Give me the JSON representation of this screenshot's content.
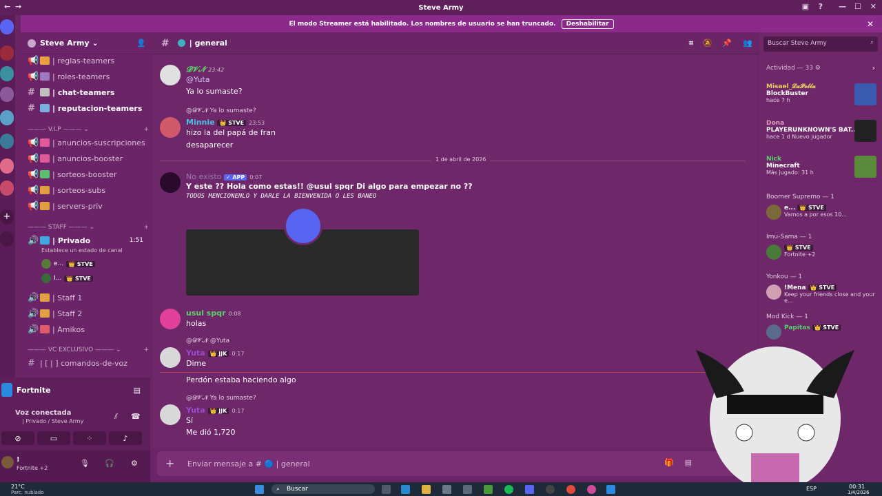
{
  "window": {
    "title": "Steve Army"
  },
  "streamer_banner": {
    "text": "El modo Streamer está habilitado. Los nombres de usuario se han truncado.",
    "button": "Deshabilitar"
  },
  "server": {
    "name": "Steve Army ⌄"
  },
  "channels_top": [
    {
      "name": "| reglas-teamers",
      "bright": false
    },
    {
      "name": "| roles-teamers",
      "bright": false
    },
    {
      "name": "| chat-teamers",
      "bright": true
    },
    {
      "name": "| reputacion-teamers",
      "bright": true
    }
  ],
  "category_vip": "——— V.I.P ——— ⌄",
  "channels_vip": [
    {
      "name": "| anuncios-suscripciones"
    },
    {
      "name": "| anuncios-booster"
    },
    {
      "name": "| sorteos-booster"
    },
    {
      "name": "| sorteos-subs"
    },
    {
      "name": "| servers-priv"
    }
  ],
  "category_staff": "——— STAFF ——— ⌄",
  "voice_private": {
    "name": "| Privado",
    "timer": "1:51",
    "status": "Establece un estado de canal"
  },
  "voice_users": [
    {
      "name": "e...",
      "badge": "👑 STVE"
    },
    {
      "name": "I...",
      "badge": "👑 STVE"
    }
  ],
  "staff_channels": [
    {
      "name": "| Staff 1"
    },
    {
      "name": "| Staff 2"
    },
    {
      "name": "| Amikos"
    }
  ],
  "category_vc": "——— VC EXCLUSIVO ——— ⌄",
  "vc_channel": "| [ | ] comandos-de-voz",
  "activity_card": {
    "game": "Fortnite"
  },
  "voice_panel": {
    "status": "Voz conectada",
    "location": "| Privado / Steve Army"
  },
  "user_panel": {
    "name": "!",
    "status": "Fortnite +2"
  },
  "chat": {
    "channel": "| general",
    "date_separator": "1 de abril de 2026",
    "composer_placeholder": "Enviar mensaje a # 🔵 | general"
  },
  "messages": [
    {
      "author": "𝓓𝓥𝓝",
      "time": "23:42",
      "reply": "",
      "lines": [
        "@Yuta",
        "Ya lo sumaste?"
      ]
    },
    {
      "author": "Minnie",
      "time": "23:53",
      "reply": "@𝓓𝓥𝓝 Ya lo sumaste?",
      "lines": [
        "hizo la del papá de fran",
        "desaparecer"
      ]
    },
    {
      "author": "No existo",
      "time": "0:07",
      "reply": "",
      "lines": [
        "Y este ?? Hola como estas!! @usul spqr Di algo para empezar no ??",
        "TODOS MENCIONENLO Y DARLE LA BIENVENIDA O LES BANEO"
      ]
    },
    {
      "author": "usul spqr",
      "time": "0:08",
      "reply": "",
      "lines": [
        "holas"
      ]
    },
    {
      "author": "Yuta",
      "time": "0:17",
      "reply": "@𝓓𝓥𝓝 @Yuta",
      "lines": [
        "Dime"
      ]
    },
    {
      "author": "",
      "time": "",
      "reply": "",
      "lines": [
        "Perdón estaba haciendo algo"
      ]
    },
    {
      "author": "Yuta",
      "time": "0:17",
      "reply": "@𝓓𝓥𝓝 Ya lo sumaste?",
      "lines": [
        "Sí",
        "Me dió 1,720"
      ]
    }
  ],
  "badges": {
    "stve": "👑 STVE",
    "jjk": "👑 JJK",
    "app": "✓ APP"
  },
  "right_panel": {
    "search_placeholder": "Buscar Steve Army",
    "activity_header": "Actividad — 33 ⚙",
    "activities": [
      {
        "name": "Misael_𝓛𝓪𝓟𝓸𝓵𝓵𝓪",
        "game": "BlockBuster",
        "sub": "hace 7 h"
      },
      {
        "name": "Dona",
        "game": "PLAYERUNKNOWN'S BAT...",
        "sub": "hace 1 d   Nuevo jugador"
      },
      {
        "name": "Nick",
        "game": "Minecraft",
        "sub": "Más jugado: 31 h"
      }
    ],
    "groups": [
      {
        "title": "Boomer Supremo — 1",
        "member": "e...",
        "badge": "👑 STVE",
        "sub": "Vamos a por esos 10..."
      },
      {
        "title": "Imu-Sama — 1",
        "member": "",
        "badge": "👑 STVE",
        "sub": "Fortnite +2"
      },
      {
        "title": "Yonkou — 1",
        "member": "!Mena",
        "badge": "👑 STVE",
        "sub": "Keep your friends close and your e..."
      },
      {
        "title": "Mod Kick — 1",
        "member": "Papitas",
        "badge": "👑 STVE",
        "sub": ""
      }
    ]
  },
  "taskbar": {
    "weather": "21°C",
    "weather_sub": "Parc. nublado",
    "search": "Buscar",
    "lang": "ESP",
    "time": "00:31",
    "date": "1/4/2026"
  },
  "colors": {
    "accent": "#8c2a8c",
    "sidebar": "#6b2467",
    "chat": "#6e2769",
    "discord": "#5865f2"
  }
}
